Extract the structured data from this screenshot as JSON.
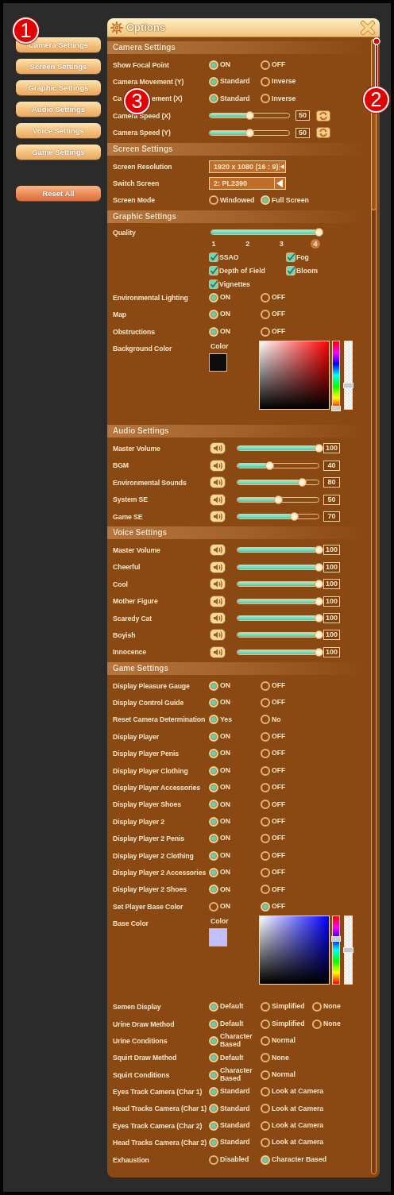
{
  "menu": [
    {
      "label": "Camera Settings"
    },
    {
      "label": "Screen Settings"
    },
    {
      "label": "Graphic Settings"
    },
    {
      "label": "Audio Settings"
    },
    {
      "label": "Voice Settings"
    },
    {
      "label": "Game Settings"
    }
  ],
  "reset_button": "Reset All",
  "window": {
    "title": "Options"
  },
  "sections": [
    {
      "title": "Camera Settings",
      "rows": [
        {
          "kind": "radio",
          "label": "Show Focal Point",
          "options": [
            {
              "label": "ON",
              "selected": true
            },
            {
              "label": "OFF",
              "selected": false
            }
          ]
        },
        {
          "kind": "radio",
          "label": "Camera Movement (Y)",
          "options": [
            {
              "label": "Standard",
              "selected": true
            },
            {
              "label": "Inverse",
              "selected": false
            }
          ]
        },
        {
          "kind": "radio",
          "label_parts": [
            "Ca",
            "ement (X)"
          ],
          "options": [
            {
              "label": "Standard",
              "selected": true
            },
            {
              "label": "Inverse",
              "selected": false
            }
          ]
        },
        {
          "kind": "slider",
          "label": "Camera Speed (X)",
          "level": 0.5,
          "value": "50"
        },
        {
          "kind": "slider",
          "label": "Camera Speed (Y)",
          "level": 0.5,
          "value": "50"
        }
      ]
    },
    {
      "title": "Screen Settings",
      "rows": [
        {
          "kind": "select",
          "label": "Screen Resolution",
          "value": "1920 x 1080 (16 : 9)"
        },
        {
          "kind": "select",
          "label": "Switch Screen",
          "value": "2: PL2390"
        },
        {
          "kind": "radio",
          "label": "Screen Mode",
          "options": [
            {
              "label": "Windowed",
              "selected": false
            },
            {
              "label": "Full Screen",
              "selected": true
            }
          ]
        }
      ]
    },
    {
      "title": "Graphic Settings",
      "rows": [
        {
          "kind": "quality",
          "label": "Quality",
          "level": 1,
          "ticks": [
            {
              "label": "1",
              "selected": false
            },
            {
              "label": "2",
              "selected": false
            },
            {
              "label": "3",
              "selected": false
            },
            {
              "label": "4",
              "selected": true
            }
          ],
          "checks": [
            {
              "label": "SSAO",
              "checked": true
            },
            {
              "label": "Fog",
              "checked": true
            },
            {
              "label": "Depth of Field",
              "checked": true
            },
            {
              "label": "Bloom",
              "checked": true
            },
            {
              "label": "Vignettes",
              "checked": true
            }
          ]
        },
        {
          "kind": "radio",
          "label": "Environmental Lighting",
          "options": [
            {
              "label": "ON",
              "selected": true
            },
            {
              "label": "OFF",
              "selected": false
            }
          ]
        },
        {
          "kind": "radio",
          "label": "Map",
          "options": [
            {
              "label": "ON",
              "selected": true
            },
            {
              "label": "OFF",
              "selected": false
            }
          ]
        },
        {
          "kind": "radio",
          "label": "Obstructions",
          "options": [
            {
              "label": "ON",
              "selected": true
            },
            {
              "label": "OFF",
              "selected": false
            }
          ]
        },
        {
          "kind": "color",
          "label": "Background Color",
          "caption": "Color",
          "color": "#0d0d0d",
          "hue": {
            "level": 0
          },
          "alpha": {
            "level": 0.35
          }
        }
      ]
    },
    {
      "title": "Audio Settings",
      "rows": [
        {
          "kind": "volume",
          "label": "Master Volume",
          "level": 1,
          "value": "100"
        },
        {
          "kind": "volume",
          "label": "BGM",
          "level": 0.4,
          "value": "40"
        },
        {
          "kind": "volume",
          "label": "Environmental Sounds",
          "level": 0.8,
          "value": "80"
        },
        {
          "kind": "volume",
          "label": "System SE",
          "level": 0.5,
          "value": "50"
        },
        {
          "kind": "volume",
          "label": "Game SE",
          "level": 0.7,
          "value": "70"
        }
      ]
    },
    {
      "title": "Voice Settings",
      "rows": [
        {
          "kind": "volume",
          "label": "Master Volume",
          "level": 1,
          "value": "100"
        },
        {
          "kind": "volume",
          "label": "Cheerful",
          "level": 1,
          "value": "100"
        },
        {
          "kind": "volume",
          "label": "Cool",
          "level": 1,
          "value": "100"
        },
        {
          "kind": "volume",
          "label": "Mother Figure",
          "level": 1,
          "value": "100"
        },
        {
          "kind": "volume",
          "label": "Scaredy Cat",
          "level": 1,
          "value": "100"
        },
        {
          "kind": "volume",
          "label": "Boyish",
          "level": 1,
          "value": "100"
        },
        {
          "kind": "volume",
          "label": "Innocence",
          "level": 1,
          "value": "100"
        }
      ]
    },
    {
      "title": "Game Settings",
      "rows": [
        {
          "kind": "radio",
          "label": "Display Pleasure Gauge",
          "options": [
            {
              "label": "ON",
              "selected": true
            },
            {
              "label": "OFF",
              "selected": false
            }
          ]
        },
        {
          "kind": "radio",
          "label": "Display Control Guide",
          "options": [
            {
              "label": "ON",
              "selected": true
            },
            {
              "label": "OFF",
              "selected": false
            }
          ]
        },
        {
          "kind": "radio",
          "label": "Reset Camera Determination",
          "options": [
            {
              "label": "Yes",
              "selected": true
            },
            {
              "label": "No",
              "selected": false
            }
          ]
        },
        {
          "kind": "radio",
          "label": "Display Player",
          "options": [
            {
              "label": "ON",
              "selected": true
            },
            {
              "label": "OFF",
              "selected": false
            }
          ]
        },
        {
          "kind": "radio",
          "label": "Display Player Penis",
          "options": [
            {
              "label": "ON",
              "selected": true
            },
            {
              "label": "OFF",
              "selected": false
            }
          ]
        },
        {
          "kind": "radio",
          "label": "Display Player Clothing",
          "options": [
            {
              "label": "ON",
              "selected": true
            },
            {
              "label": "OFF",
              "selected": false
            }
          ]
        },
        {
          "kind": "radio",
          "label": "Display Player Accessories",
          "options": [
            {
              "label": "ON",
              "selected": true
            },
            {
              "label": "OFF",
              "selected": false
            }
          ]
        },
        {
          "kind": "radio",
          "label": "Display Player Shoes",
          "options": [
            {
              "label": "ON",
              "selected": true
            },
            {
              "label": "OFF",
              "selected": false
            }
          ]
        },
        {
          "kind": "radio",
          "label": "Display Player 2",
          "options": [
            {
              "label": "ON",
              "selected": true
            },
            {
              "label": "OFF",
              "selected": false
            }
          ]
        },
        {
          "kind": "radio",
          "label": "Display Player 2 Penis",
          "options": [
            {
              "label": "ON",
              "selected": true
            },
            {
              "label": "OFF",
              "selected": false
            }
          ]
        },
        {
          "kind": "radio",
          "label": "Display Player 2 Clothing",
          "options": [
            {
              "label": "ON",
              "selected": true
            },
            {
              "label": "OFF",
              "selected": false
            }
          ]
        },
        {
          "kind": "radio",
          "label": "Display Player 2 Accessories",
          "options": [
            {
              "label": "ON",
              "selected": true
            },
            {
              "label": "OFF",
              "selected": false
            }
          ]
        },
        {
          "kind": "radio",
          "label": "Display Player 2 Shoes",
          "options": [
            {
              "label": "ON",
              "selected": true
            },
            {
              "label": "OFF",
              "selected": false
            }
          ]
        },
        {
          "kind": "radio",
          "label": "Set Player Base Color",
          "options": [
            {
              "label": "ON",
              "selected": false
            },
            {
              "label": "OFF",
              "selected": true
            }
          ]
        },
        {
          "kind": "color",
          "label": "Base Color",
          "caption": "Color",
          "color": "#c0c0ff",
          "hue": {
            "level": 0.667
          },
          "alpha": {
            "level": 0.5
          }
        },
        {
          "kind": "radio",
          "label": "Semen Display",
          "options": [
            {
              "label": "Default",
              "selected": true
            },
            {
              "label": "Simplified",
              "selected": false
            },
            {
              "label": "None",
              "selected": false
            }
          ]
        },
        {
          "kind": "radio",
          "label": "Urine Draw Method",
          "options": [
            {
              "label": "Default",
              "selected": true
            },
            {
              "label": "Simplified",
              "selected": false
            },
            {
              "label": "None",
              "selected": false
            }
          ]
        },
        {
          "kind": "radio",
          "label": "Urine Conditions",
          "options": [
            {
              "label": "Character Based",
              "selected": true
            },
            {
              "label": "Normal",
              "selected": false
            }
          ]
        },
        {
          "kind": "radio",
          "label": "Squirt Draw Method",
          "options": [
            {
              "label": "Default",
              "selected": true
            },
            {
              "label": "None",
              "selected": false
            }
          ]
        },
        {
          "kind": "radio",
          "label": "Squirt Conditions",
          "options": [
            {
              "label": "Character Based",
              "selected": true
            },
            {
              "label": "Normal",
              "selected": false
            }
          ]
        },
        {
          "kind": "radio",
          "label": "Eyes Track Camera (Char 1)",
          "options": [
            {
              "label": "Standard",
              "selected": true
            },
            {
              "label": "Look at Camera",
              "selected": false
            }
          ]
        },
        {
          "kind": "radio",
          "label": "Head Tracks Camera (Char 1)",
          "options": [
            {
              "label": "Standard",
              "selected": true
            },
            {
              "label": "Look at Camera",
              "selected": false
            }
          ]
        },
        {
          "kind": "radio",
          "label": "Eyes Track Camera (Char 2)",
          "options": [
            {
              "label": "Standard",
              "selected": true
            },
            {
              "label": "Look at Camera",
              "selected": false
            }
          ]
        },
        {
          "kind": "radio",
          "label": "Head Tracks Camera (Char 2)",
          "options": [
            {
              "label": "Standard",
              "selected": true
            },
            {
              "label": "Look at Camera",
              "selected": false
            }
          ]
        },
        {
          "kind": "radio",
          "label": "Exhaustion",
          "options": [
            {
              "label": "Disabled",
              "selected": false
            },
            {
              "label": "Character Based",
              "selected": true
            }
          ]
        }
      ]
    }
  ],
  "annotations": [
    {
      "label": "1"
    },
    {
      "label": "2"
    },
    {
      "label": "3"
    }
  ]
}
